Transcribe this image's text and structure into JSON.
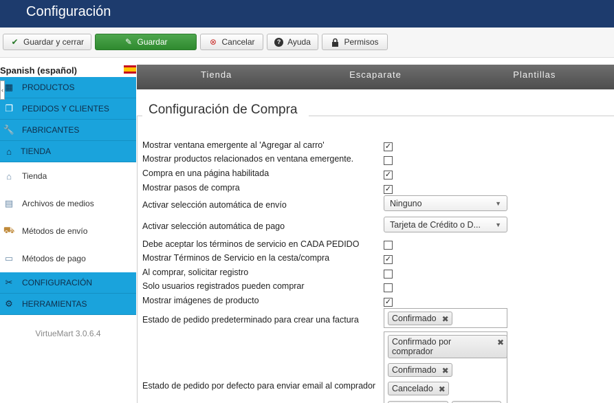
{
  "header": {
    "title": "Configuración"
  },
  "toolbar": {
    "save_close": "Guardar y cerrar",
    "save": "Guardar",
    "cancel": "Cancelar",
    "help": "Ayuda",
    "permissions": "Permisos"
  },
  "sidebar": {
    "language": "Spanish (español)",
    "items": [
      {
        "label": "PRODUCTOS"
      },
      {
        "label": "PEDIDOS Y CLIENTES"
      },
      {
        "label": "FABRICANTES"
      },
      {
        "label": "TIENDA"
      },
      {
        "label": "Tienda"
      },
      {
        "label": "Archivos de medios"
      },
      {
        "label": "Métodos de envío"
      },
      {
        "label": "Métodos de pago"
      },
      {
        "label": "CONFIGURACIÓN"
      },
      {
        "label": "HERRAMIENTAS"
      }
    ],
    "version": "VirtueMart 3.0.6.4"
  },
  "tabs": [
    "Tienda",
    "Escaparate",
    "Plantillas"
  ],
  "section": {
    "title": "Configuración de Compra"
  },
  "options": [
    {
      "label": "Mostrar ventana emergente al 'Agregar al carro'",
      "checked": true
    },
    {
      "label": "Mostrar productos relacionados en ventana emergente.",
      "checked": false
    },
    {
      "label": "Compra en una página habilitada",
      "checked": true
    },
    {
      "label": "Mostrar pasos de compra",
      "checked": true
    },
    {
      "label": "Activar selección automática de envío",
      "select": "Ninguno"
    },
    {
      "label": "Activar selección automática de pago",
      "select": "Tarjeta de Crédito o D..."
    },
    {
      "label": "Debe aceptar los términos de servicio en CADA PEDIDO",
      "checked": false
    },
    {
      "label": "Mostrar Términos de Servicio en la cesta/compra",
      "checked": true
    },
    {
      "label": "Al comprar, solicitar registro",
      "checked": false
    },
    {
      "label": "Solo usuarios registrados pueden comprar",
      "checked": false
    },
    {
      "label": "Mostrar imágenes de producto",
      "checked": true
    }
  ],
  "invoice_status": {
    "label": "Estado de pedido predeterminado para crear una factura",
    "chips": [
      "Confirmado"
    ]
  },
  "email_status": {
    "label": "Estado de pedido por defecto para enviar email al comprador",
    "chips": [
      "Confirmado por comprador",
      "Confirmado",
      "Cancelado"
    ]
  }
}
